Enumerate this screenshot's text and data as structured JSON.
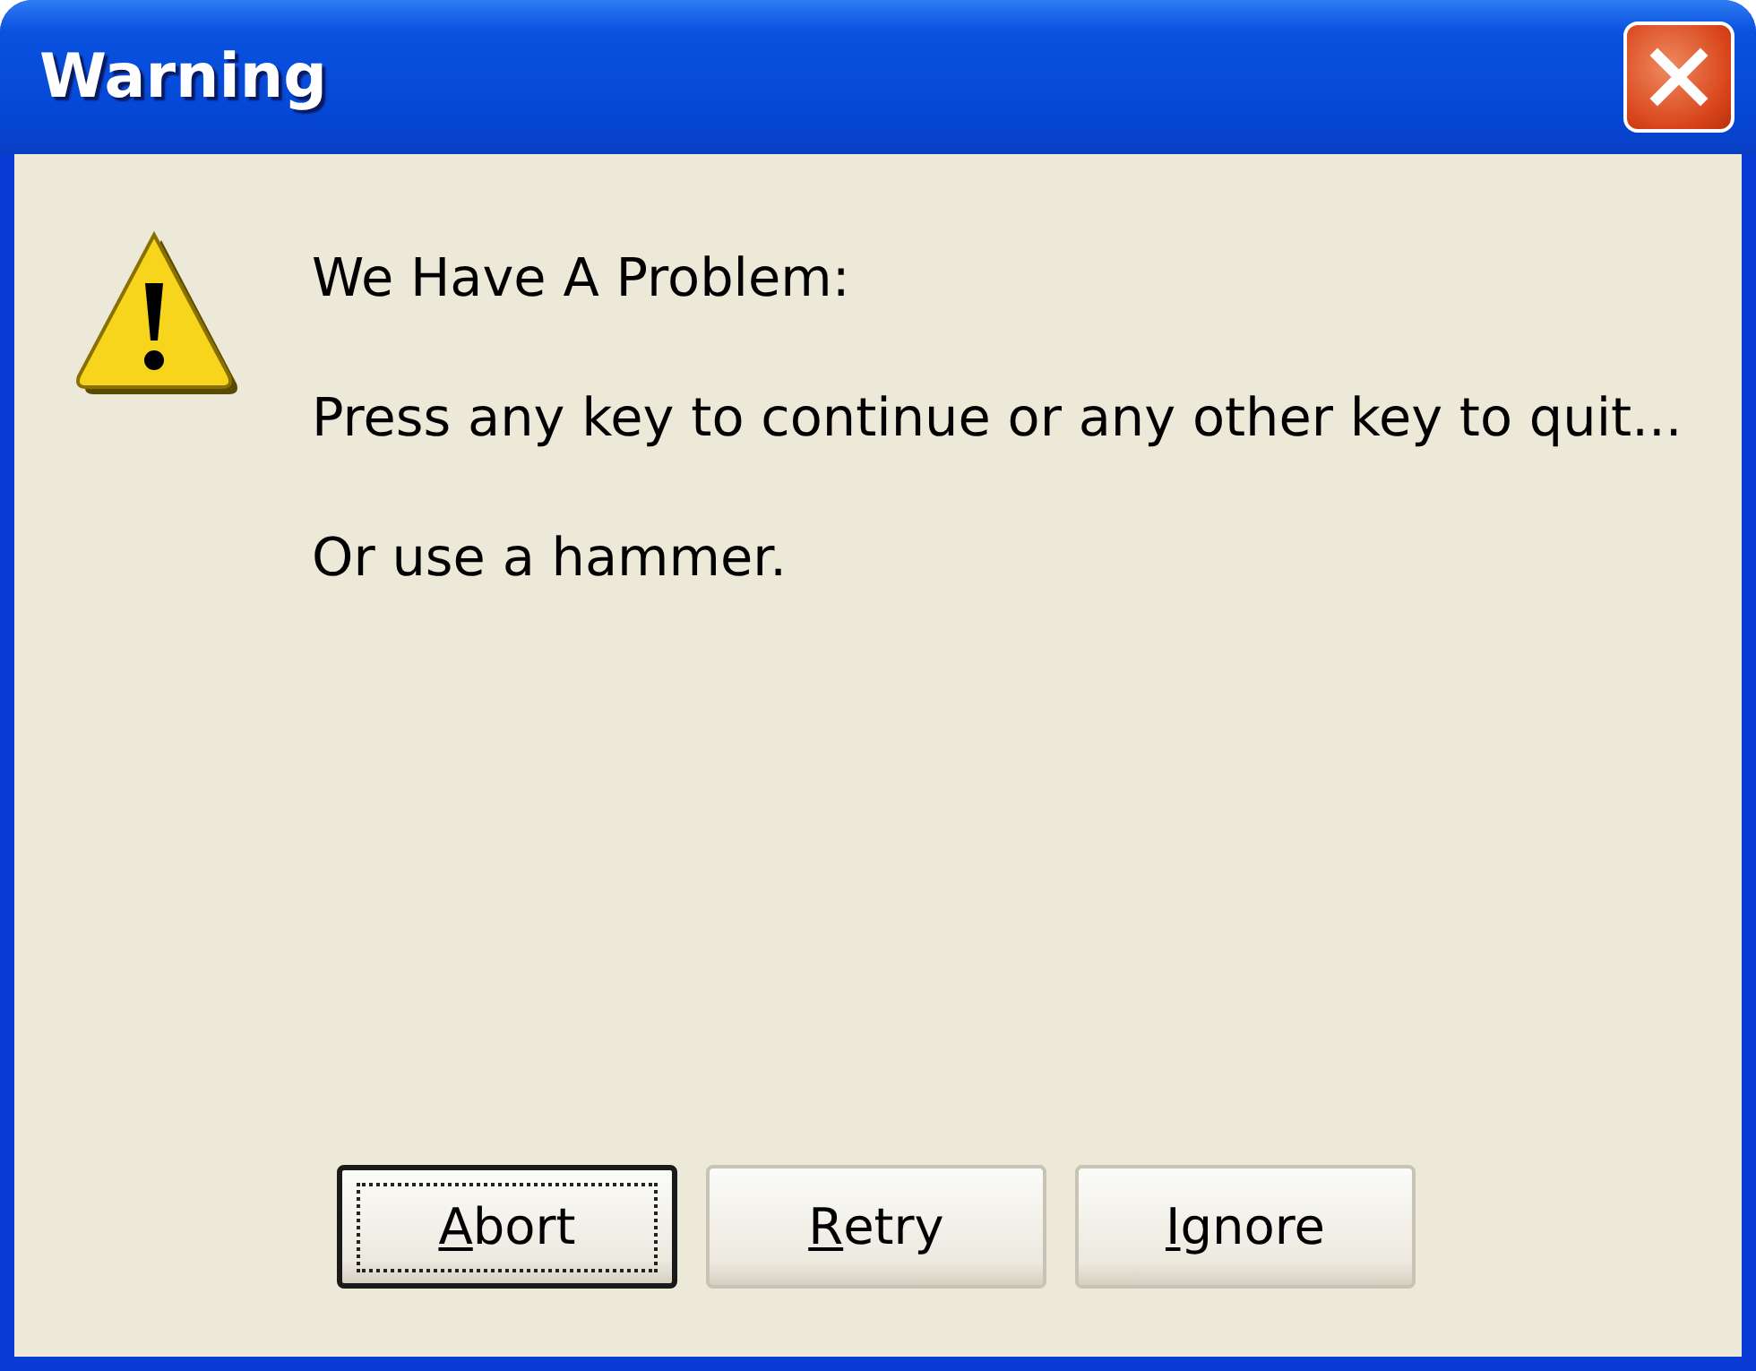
{
  "window": {
    "title": "Warning"
  },
  "message": {
    "lines": [
      "We Have A Problem:",
      "Press any key to continue or any other key to quit...",
      "Or use a hammer."
    ]
  },
  "buttons": [
    {
      "label": "Abort",
      "focused": true,
      "mnemonic": true
    },
    {
      "label": "Retry",
      "focused": false,
      "mnemonic": true
    },
    {
      "label": "Ignore",
      "focused": false,
      "mnemonic": true
    }
  ]
}
